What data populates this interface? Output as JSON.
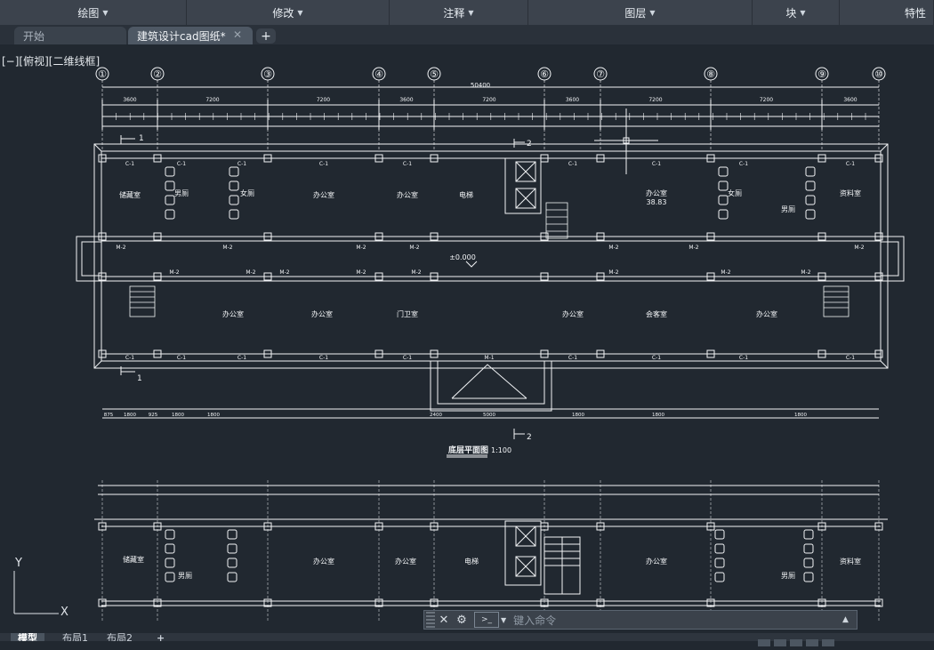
{
  "ribbon": {
    "panels": [
      {
        "label": "绘图",
        "width": 210
      },
      {
        "label": "修改",
        "width": 228
      },
      {
        "label": "注释",
        "width": 156
      },
      {
        "label": "图层",
        "width": 252
      },
      {
        "label": "块",
        "width": 98
      },
      {
        "label": "特性",
        "width": 106
      }
    ]
  },
  "tabs": {
    "start_label": "开始",
    "doc_label": "建筑设计cad图纸*",
    "close_glyph": "✕",
    "new_tab_glyph": "+"
  },
  "viewport": {
    "label": "[−][俯视][二维线框]"
  },
  "drawing": {
    "axis_labels": [
      "①",
      "②",
      "③",
      "④",
      "⑤",
      "⑥",
      "⑦",
      "⑧",
      "⑨",
      "⑩"
    ],
    "overall_dimension": "50400",
    "bay_dimensions": [
      "3600",
      "7200",
      "7200",
      "3600",
      "7200",
      "3600",
      "7200",
      "7200",
      "3600"
    ],
    "room_labels": {
      "r1": "储藏室",
      "r2": "男厕",
      "r3": "女厕",
      "r4": "办公室",
      "r5": "办公室",
      "r6": "电梯",
      "r7": "办公室",
      "r7b": "38.83",
      "r8": "女厕",
      "r9": "男厕",
      "r10": "资料室",
      "r11": "办公室",
      "r12": "办公室",
      "r13": "门卫室",
      "r14": "办公室",
      "r15": "会客室",
      "r16": "办公室"
    },
    "window_tag": "C-1",
    "door_tag": "M-2",
    "main_door_tag": "M-1",
    "level_mark": "±0.000",
    "section_1": "1",
    "section_2": "2",
    "plan_title": "底层平面图",
    "plan_scale": "1:100",
    "lower_labels": {
      "a": "储藏室",
      "b": "男厕",
      "c": "办公室",
      "d": "办公室",
      "e": "电梯",
      "f": "办公室",
      "g": "男厕",
      "h": "资料室"
    },
    "bottom_dims": [
      "875",
      "1800",
      "925",
      "1800",
      "1800",
      "2400",
      "5000",
      "1800",
      "1800",
      "1800"
    ]
  },
  "ucs": {
    "y": "Y",
    "x": "X"
  },
  "command": {
    "close_icon": "✕",
    "settings_icon": "wrench-icon",
    "placeholder": "键入命令"
  },
  "layout_tabs": {
    "model": "模型",
    "layout1": "布局1",
    "layout2": "布局2",
    "add": "+"
  },
  "colors": {
    "background": "#212830",
    "line": "#f2f4f6",
    "ribbon": "#3c434d"
  }
}
